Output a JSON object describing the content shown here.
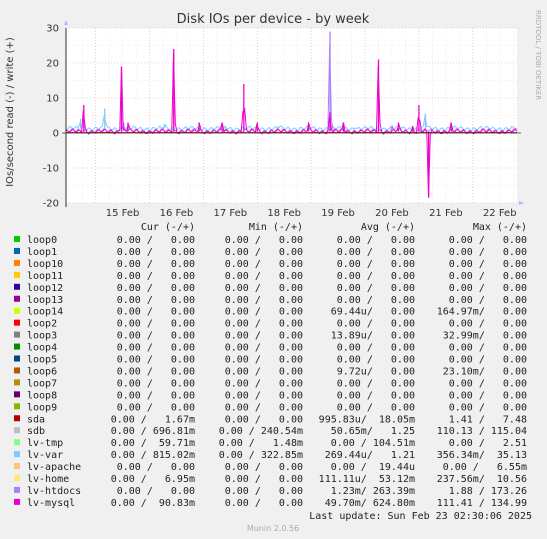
{
  "chart_data": {
    "type": "line",
    "title": "Disk IOs per device - by week",
    "ylabel": "IOs/second read (-) / write (+)",
    "ylim": [
      -20,
      30
    ],
    "y_ticks": [
      "30",
      "20",
      "10",
      "0",
      "-10",
      "-20"
    ],
    "x_ticks": [
      "15 Feb",
      "16 Feb",
      "17 Feb",
      "18 Feb",
      "19 Feb",
      "20 Feb",
      "21 Feb",
      "22 Feb"
    ],
    "x_range_days": [
      14.45,
      22.82
    ],
    "grid": true,
    "side_label": "RRDTOOL / TOBI OETIKER",
    "columns": [
      "Cur (-/+)",
      "Min (-/+)",
      "Avg (-/+)",
      "Max (-/+)"
    ],
    "series": [
      {
        "name": "loop0",
        "color": "#00cc00",
        "cur": "0.00 /   0.00",
        "min": "0.00 /   0.00",
        "avg": "0.00 /   0.00",
        "max": "0.00 /   0.00"
      },
      {
        "name": "loop1",
        "color": "#0066b3",
        "cur": "0.00 /   0.00",
        "min": "0.00 /   0.00",
        "avg": "0.00 /   0.00",
        "max": "0.00 /   0.00"
      },
      {
        "name": "loop10",
        "color": "#ff8000",
        "cur": "0.00 /   0.00",
        "min": "0.00 /   0.00",
        "avg": "0.00 /   0.00",
        "max": "0.00 /   0.00"
      },
      {
        "name": "loop11",
        "color": "#ffcc00",
        "cur": "0.00 /   0.00",
        "min": "0.00 /   0.00",
        "avg": "0.00 /   0.00",
        "max": "0.00 /   0.00"
      },
      {
        "name": "loop12",
        "color": "#330099",
        "cur": "0.00 /   0.00",
        "min": "0.00 /   0.00",
        "avg": "0.00 /   0.00",
        "max": "0.00 /   0.00"
      },
      {
        "name": "loop13",
        "color": "#990099",
        "cur": "0.00 /   0.00",
        "min": "0.00 /   0.00",
        "avg": "0.00 /   0.00",
        "max": "0.00 /   0.00"
      },
      {
        "name": "loop14",
        "color": "#ccff00",
        "cur": "0.00 /   0.00",
        "min": "0.00 /   0.00",
        "avg": "69.44u/   0.00",
        "max": "164.97m/   0.00"
      },
      {
        "name": "loop2",
        "color": "#ff0000",
        "cur": "0.00 /   0.00",
        "min": "0.00 /   0.00",
        "avg": "0.00 /   0.00",
        "max": "0.00 /   0.00"
      },
      {
        "name": "loop3",
        "color": "#808080",
        "cur": "0.00 /   0.00",
        "min": "0.00 /   0.00",
        "avg": "13.89u/   0.00",
        "max": "32.99m/   0.00"
      },
      {
        "name": "loop4",
        "color": "#008f00",
        "cur": "0.00 /   0.00",
        "min": "0.00 /   0.00",
        "avg": "0.00 /   0.00",
        "max": "0.00 /   0.00"
      },
      {
        "name": "loop5",
        "color": "#00487d",
        "cur": "0.00 /   0.00",
        "min": "0.00 /   0.00",
        "avg": "0.00 /   0.00",
        "max": "0.00 /   0.00"
      },
      {
        "name": "loop6",
        "color": "#b35a00",
        "cur": "0.00 /   0.00",
        "min": "0.00 /   0.00",
        "avg": "9.72u/   0.00",
        "max": "23.10m/   0.00"
      },
      {
        "name": "loop7",
        "color": "#b38f00",
        "cur": "0.00 /   0.00",
        "min": "0.00 /   0.00",
        "avg": "0.00 /   0.00",
        "max": "0.00 /   0.00"
      },
      {
        "name": "loop8",
        "color": "#6b006b",
        "cur": "0.00 /   0.00",
        "min": "0.00 /   0.00",
        "avg": "0.00 /   0.00",
        "max": "0.00 /   0.00"
      },
      {
        "name": "loop9",
        "color": "#8fb300",
        "cur": "0.00 /   0.00",
        "min": "0.00 /   0.00",
        "avg": "0.00 /   0.00",
        "max": "0.00 /   0.00"
      },
      {
        "name": "sda",
        "color": "#b30000",
        "cur": "0.00 /   1.67m",
        "min": "0.00 /   0.00",
        "avg": "995.83u/  18.05m",
        "max": "1.41 /   7.48"
      },
      {
        "name": "sdb",
        "color": "#bebebe",
        "cur": "0.00 / 696.81m",
        "min": "0.00 / 240.54m",
        "avg": "50.65m/   1.25",
        "max": "110.13 / 115.04"
      },
      {
        "name": "lv-tmp",
        "color": "#80ff80",
        "cur": "0.00 /  59.71m",
        "min": "0.00 /   1.48m",
        "avg": "0.00 / 104.51m",
        "max": "0.00 /   2.51"
      },
      {
        "name": "lv-var",
        "color": "#80c9ff",
        "cur": "0.00 / 815.02m",
        "min": "0.00 / 322.85m",
        "avg": "269.44u/   1.21",
        "max": "356.34m/  35.13"
      },
      {
        "name": "lv-apache",
        "color": "#ffc080",
        "cur": "0.00 /   0.00",
        "min": "0.00 /   0.00",
        "avg": "0.00 /  19.44u",
        "max": "0.00 /   6.55m"
      },
      {
        "name": "lv-home",
        "color": "#ffe680",
        "cur": "0.00 /   6.95m",
        "min": "0.00 /   0.00",
        "avg": "111.11u/  53.12m",
        "max": "237.56m/  10.56"
      },
      {
        "name": "lv-htdocs",
        "color": "#aa80ff",
        "cur": "0.00 /   0.00",
        "min": "0.00 /   0.00",
        "avg": "1.23m/ 263.39m",
        "max": "1.88 / 173.26"
      },
      {
        "name": "lv-mysql",
        "color": "#ee00cc",
        "cur": "0.00 /  90.83m",
        "min": "0.00 /   0.00",
        "avg": "49.70m/ 624.80m",
        "max": "111.41 / 134.99"
      }
    ],
    "plotted": [
      {
        "name": "lv-var",
        "color": "#80c9ff",
        "baseline": 1.3,
        "spikes": [
          [
            14.72,
            4
          ],
          [
            15.17,
            7
          ],
          [
            16.28,
            2.5
          ],
          [
            17.4,
            2
          ],
          [
            18.4,
            2
          ],
          [
            19.82,
            1.5
          ],
          [
            21.12,
            5.5
          ]
        ]
      },
      {
        "name": "lv-htdocs",
        "color": "#aa80ff",
        "baseline": 0.6,
        "spikes": [
          [
            19.35,
            29
          ],
          [
            15.52,
            3
          ],
          [
            20.5,
            2
          ]
        ]
      },
      {
        "name": "lv-mysql",
        "color": "#ee00cc",
        "baseline": 0.4,
        "spikes": [
          [
            14.78,
            8
          ],
          [
            15.48,
            19
          ],
          [
            15.6,
            3
          ],
          [
            16.45,
            24
          ],
          [
            16.92,
            3
          ],
          [
            17.35,
            3
          ],
          [
            17.75,
            14
          ],
          [
            18.0,
            3
          ],
          [
            18.95,
            3
          ],
          [
            19.35,
            6
          ],
          [
            19.6,
            3
          ],
          [
            20.25,
            21
          ],
          [
            20.62,
            3
          ],
          [
            20.88,
            2
          ],
          [
            21.0,
            8
          ],
          [
            21.18,
            -18.5
          ],
          [
            21.6,
            3
          ]
        ]
      }
    ]
  },
  "footer": {
    "last_update": "Last update: Sun Feb 23 02:30:06 2025",
    "version": "Munin 2.0.56"
  }
}
